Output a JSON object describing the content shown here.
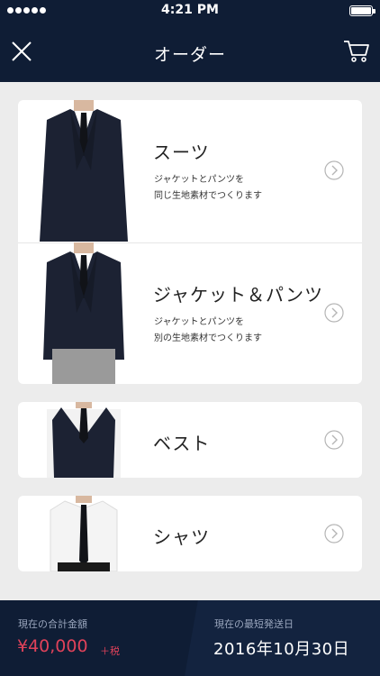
{
  "status_bar": {
    "time": "4:21 PM",
    "signal_dots": 5
  },
  "nav": {
    "title": "オーダー",
    "close_icon": "close-icon",
    "cart_icon": "cart-icon"
  },
  "items": [
    {
      "title": "スーツ",
      "desc_line1": "ジャケットとパンツを",
      "desc_line2": "同じ生地素材でつくります",
      "image": "suit-image"
    },
    {
      "title": "ジャケット＆パンツ",
      "desc_line1": "ジャケットとパンツを",
      "desc_line2": "別の生地素材でつくります",
      "image": "jacket-pants-image"
    },
    {
      "title": "ベスト",
      "image": "vest-image"
    },
    {
      "title": "シャツ",
      "image": "shirt-image"
    }
  ],
  "footer": {
    "total_label": "現在の合計金額",
    "total_price": "¥40,000",
    "tax_note": "＋税",
    "ship_label": "現在の最短発送日",
    "ship_date": "2016年10月30日"
  },
  "colors": {
    "navy": "#0f1d35",
    "accent_red": "#e0425a",
    "background": "#ececec"
  }
}
